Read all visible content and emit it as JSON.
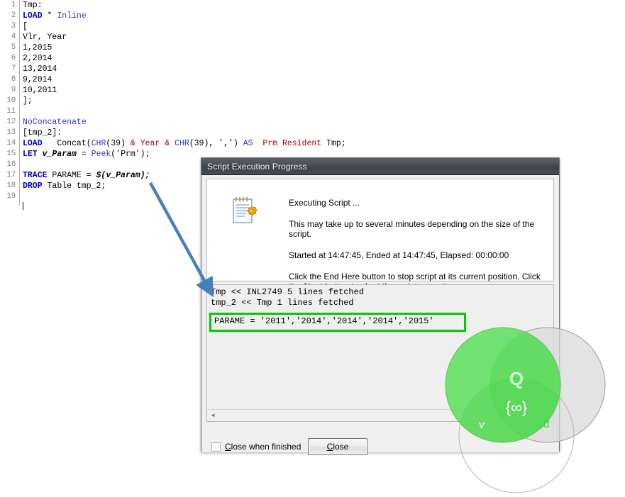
{
  "editor": {
    "lines": [
      {
        "n": "1",
        "tokens": [
          {
            "t": "Tmp:",
            "c": "plain"
          }
        ]
      },
      {
        "n": "2",
        "tokens": [
          {
            "t": "LOAD",
            "c": "kw"
          },
          {
            "t": " * ",
            "c": "plain"
          },
          {
            "t": "Inline",
            "c": "fn"
          }
        ]
      },
      {
        "n": "3",
        "tokens": [
          {
            "t": "[",
            "c": "plain"
          }
        ]
      },
      {
        "n": "4",
        "tokens": [
          {
            "t": "Vlr, Year",
            "c": "plain"
          }
        ]
      },
      {
        "n": "5",
        "tokens": [
          {
            "t": "1,2015",
            "c": "plain"
          }
        ]
      },
      {
        "n": "6",
        "tokens": [
          {
            "t": "2,2014",
            "c": "plain"
          }
        ]
      },
      {
        "n": "7",
        "tokens": [
          {
            "t": "13,2014",
            "c": "plain"
          }
        ]
      },
      {
        "n": "8",
        "tokens": [
          {
            "t": "9,2014",
            "c": "plain"
          }
        ]
      },
      {
        "n": "9",
        "tokens": [
          {
            "t": "10,2011",
            "c": "plain"
          }
        ]
      },
      {
        "n": "10",
        "tokens": [
          {
            "t": "];",
            "c": "plain"
          }
        ]
      },
      {
        "n": "11",
        "tokens": []
      },
      {
        "n": "12",
        "tokens": [
          {
            "t": "NoConcatenate",
            "c": "fn"
          }
        ]
      },
      {
        "n": "13",
        "tokens": [
          {
            "t": "[tmp_2]:",
            "c": "plain"
          }
        ]
      },
      {
        "n": "14",
        "tokens": [
          {
            "t": "LOAD",
            "c": "kw"
          },
          {
            "t": "   ",
            "c": "plain"
          },
          {
            "t": "Concat",
            "c": "plain"
          },
          {
            "t": "(",
            "c": "plain"
          },
          {
            "t": "CHR",
            "c": "fn"
          },
          {
            "t": "(39) ",
            "c": "plain"
          },
          {
            "t": "&",
            "c": "amp"
          },
          {
            "t": " ",
            "c": "plain"
          },
          {
            "t": "Year",
            "c": "field"
          },
          {
            "t": " ",
            "c": "plain"
          },
          {
            "t": "&",
            "c": "amp"
          },
          {
            "t": " ",
            "c": "plain"
          },
          {
            "t": "CHR",
            "c": "fn"
          },
          {
            "t": "(39), ",
            "c": "plain"
          },
          {
            "t": "','",
            "c": "plain"
          },
          {
            "t": ") ",
            "c": "plain"
          },
          {
            "t": "AS",
            "c": "fn"
          },
          {
            "t": "  ",
            "c": "plain"
          },
          {
            "t": "Prm",
            "c": "field"
          },
          {
            "t": " ",
            "c": "plain"
          },
          {
            "t": "Resident",
            "c": "field"
          },
          {
            "t": " Tmp;",
            "c": "plain"
          }
        ]
      },
      {
        "n": "15",
        "tokens": [
          {
            "t": "LET",
            "c": "kw"
          },
          {
            "t": " ",
            "c": "plain"
          },
          {
            "t": "v_Param",
            "c": "var"
          },
          {
            "t": " = ",
            "c": "plain"
          },
          {
            "t": "Peek",
            "c": "fn"
          },
          {
            "t": "('Prm');",
            "c": "plain"
          }
        ]
      },
      {
        "n": "16",
        "tokens": []
      },
      {
        "n": "17",
        "tokens": [
          {
            "t": "TRACE",
            "c": "kw"
          },
          {
            "t": " PARAME = ",
            "c": "plain"
          },
          {
            "t": "$(v_Param);",
            "c": "var"
          }
        ]
      },
      {
        "n": "18",
        "tokens": [
          {
            "t": "DROP",
            "c": "kw"
          },
          {
            "t": " Table tmp_2;",
            "c": "plain"
          }
        ]
      },
      {
        "n": "19",
        "tokens": []
      }
    ],
    "caret_line": "20"
  },
  "dialog": {
    "title": "Script Execution Progress",
    "icon": "script-document-icon",
    "info": [
      "Executing Script ...",
      "This may take up to several minutes depending on the size of the script.",
      "Started at 14:47:45, Ended at 14:47:45,  Elapsed: 00:00:00",
      "Click the End Here button to stop script at its current position. Click the Abort button to abort the script execution."
    ],
    "log": {
      "lines": [
        "Tmp << INL2749 5 lines fetched",
        "tmp_2 << Tmp 1 lines fetched"
      ],
      "highlighted_line": "PARAME = '2011','2014','2014','2014','2015'",
      "highlight_color": "#00cc00",
      "scroll_left_arrow": "◄"
    },
    "checkbox": {
      "label_pre": "C",
      "label_post": "lose when finished",
      "checked": false
    },
    "close_button": {
      "label_pre": "C",
      "label_post": "lose"
    }
  },
  "annotation": {
    "arrow_color": "#4a7ebb",
    "name": "callout-arrow"
  },
  "watermark": {
    "name": "venn-logo-watermark",
    "green": "#66e066",
    "grey": "#d9d9d9",
    "labels": {
      "top_right_circle": "Q",
      "center": "{∞}",
      "bottom_left": "v",
      "right": "d"
    }
  }
}
